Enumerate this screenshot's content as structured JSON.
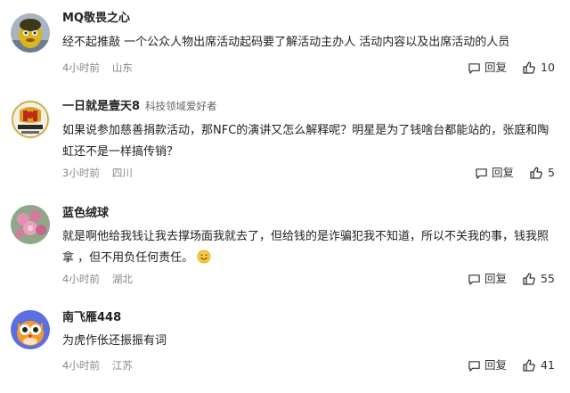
{
  "comments": [
    {
      "username": "MQ敬畏之心",
      "tag": "",
      "text": "经不起推敲 一个公众人物出席活动起码要了解活动主办人 活动内容以及出席活动的人员",
      "time": "4小时前",
      "location": "山东",
      "reply_label": "回复",
      "likes": "10",
      "avatar_icon": "yellow-character-avatar"
    },
    {
      "username": "一日就是壹天8",
      "tag": "科技领域爱好者",
      "text": "如果说参加慈善捐款活动，那NFC的演讲又怎么解释呢？明星是为了钱啥台都能站的，张庭和陶虹还不是一样搞传销？",
      "time": "3小时前",
      "location": "四川",
      "reply_label": "回复",
      "likes": "5",
      "avatar_icon": "emblem-avatar"
    },
    {
      "username": "蓝色绒球",
      "tag": "",
      "text": "就是啊他给我钱让我去撑场面我就去了，但给钱的是诈骗犯我不知道，所以不关我的事，钱我照拿 ，但不用负任何责任。",
      "time": "4小时前",
      "location": "湖北",
      "reply_label": "回复",
      "likes": "55",
      "avatar_icon": "pink-flower-avatar",
      "emoji": "smile-emoji"
    },
    {
      "username": "南飞雁448",
      "tag": "",
      "text": "为虎作伥还振振有词",
      "time": "4小时前",
      "location": "江苏",
      "reply_label": "回复",
      "likes": "41",
      "avatar_icon": "owl-avatar"
    }
  ],
  "colors": {
    "text": "#222222",
    "meta": "#888888",
    "action": "#333333"
  }
}
